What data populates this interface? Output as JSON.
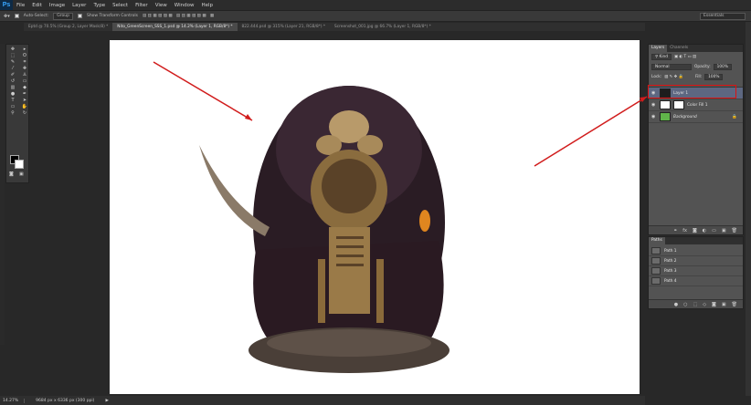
{
  "app": {
    "logo": "Ps",
    "menus": [
      "File",
      "Edit",
      "Image",
      "Layer",
      "Type",
      "Select",
      "Filter",
      "View",
      "Window",
      "Help"
    ]
  },
  "options_bar": {
    "auto_select_label": "Auto-Select:",
    "auto_select_value": "Group",
    "show_transform_label": "Show Transform Controls",
    "workspace": "Essentials"
  },
  "tabs": [
    {
      "label": "Eptd @ 70.5% (Group 2, Layer Mask/8) *",
      "active": false
    },
    {
      "label": "Nito_GreenScreen_SSS_1.psd @ 14.2% (Layer 1, RGB/8*) *",
      "active": true
    },
    {
      "label": "822.444.psd @ 315% (Layer 21, RGB/8*) *",
      "active": false
    },
    {
      "label": "Screenshot_001.jpg @ 66.7% (Layer 1, RGB/8*) *",
      "active": false
    }
  ],
  "status": {
    "zoom": "14.27%",
    "doc_info": "9684 px x 6336 px (300 ppi)"
  },
  "layers_panel": {
    "tabs": [
      "Layers",
      "Channels"
    ],
    "filter": "Kind",
    "blend_mode": "Normal",
    "opacity_label": "Opacity:",
    "opacity_value": "100%",
    "lock_label": "Lock:",
    "fill_label": "Fill:",
    "fill_value": "100%",
    "layers": [
      {
        "name": "Layer 1",
        "selected": true
      },
      {
        "name": "Color Fill 1",
        "selected": false
      },
      {
        "name": "Background",
        "selected": false
      }
    ]
  },
  "paths_panel": {
    "tab": "Paths",
    "paths": [
      "Path 1",
      "Path 2",
      "Path 3",
      "Path 4"
    ]
  },
  "toolbar": {
    "tools": [
      "move-tool",
      "artboard-tool",
      "marquee-tool",
      "lasso-tool",
      "quick-select-tool",
      "magic-wand-tool",
      "crop-tool",
      "slice-tool",
      "eyedropper-tool",
      "ruler-tool",
      "healing-brush-tool",
      "patch-tool",
      "brush-tool",
      "pencil-tool",
      "clone-stamp-tool",
      "pattern-stamp-tool",
      "history-brush-tool",
      "art-history-tool",
      "eraser-tool",
      "bg-eraser-tool",
      "gradient-tool",
      "paint-bucket-tool",
      "blur-tool",
      "sharpen-tool",
      "dodge-tool",
      "burn-tool",
      "pen-tool",
      "freeform-pen-tool",
      "type-tool",
      "vertical-type-tool",
      "path-select-tool",
      "direct-select-tool",
      "rectangle-tool",
      "ellipse-tool",
      "hand-tool",
      "rotate-view-tool",
      "zoom-tool"
    ]
  },
  "colors": {
    "annotation_red": "#d11c1c",
    "selected_layer": "#5d6781",
    "canvas": "#ffffff"
  }
}
